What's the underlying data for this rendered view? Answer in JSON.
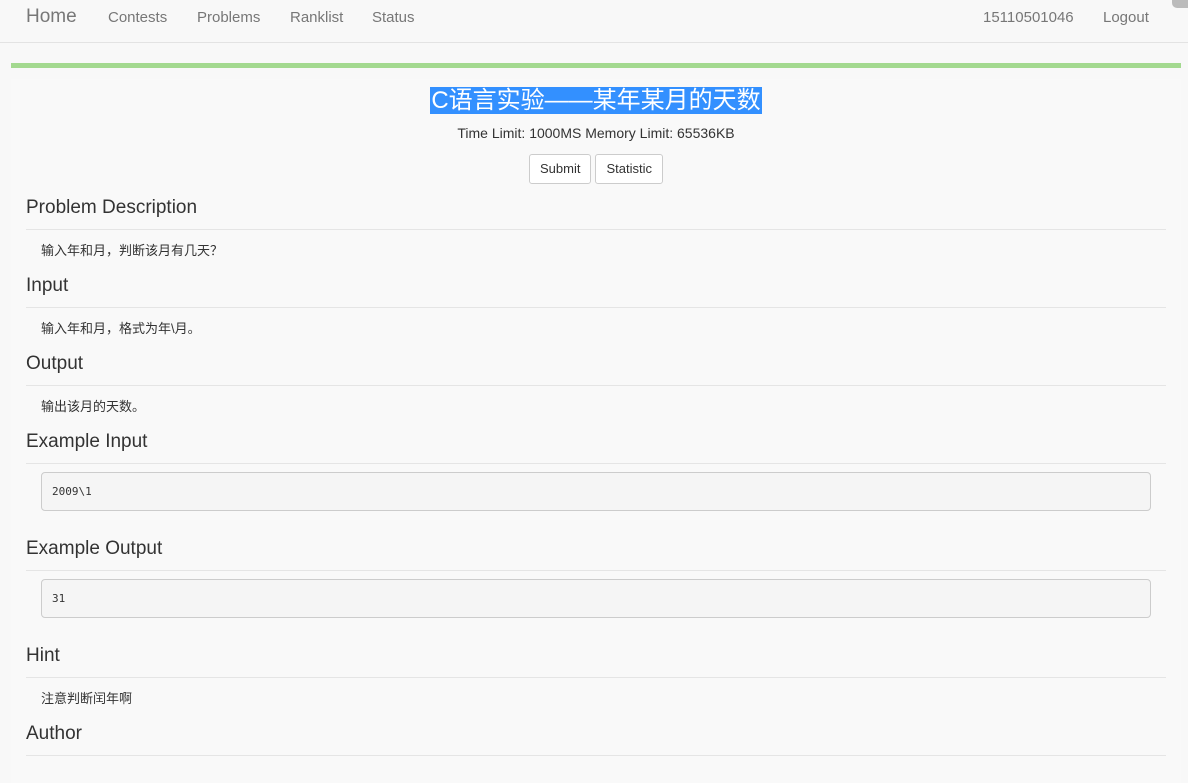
{
  "navbar": {
    "brand": "Home",
    "links": [
      "Contests",
      "Problems",
      "Ranklist",
      "Status"
    ],
    "user": "15110501046",
    "logout": "Logout"
  },
  "problem": {
    "title": "C语言实验——某年某月的天数",
    "limits": "Time Limit: 1000MS Memory Limit: 65536KB",
    "buttons": {
      "submit": "Submit",
      "statistic": "Statistic"
    }
  },
  "sections": {
    "description": {
      "heading": "Problem Description",
      "text": "输入年和月，判断该月有几天？"
    },
    "input": {
      "heading": "Input",
      "text": "输入年和月，格式为年\\月。"
    },
    "output": {
      "heading": "Output",
      "text": "输出该月的天数。"
    },
    "example_input": {
      "heading": "Example Input",
      "code": "2009\\1"
    },
    "example_output": {
      "heading": "Example Output",
      "code": "31"
    },
    "hint": {
      "heading": "Hint",
      "text": "注意判断闰年啊"
    },
    "author": {
      "heading": "Author",
      "text": ""
    }
  },
  "colors": {
    "accent_bar": "#a3d98f",
    "selection": "#3390ff"
  }
}
